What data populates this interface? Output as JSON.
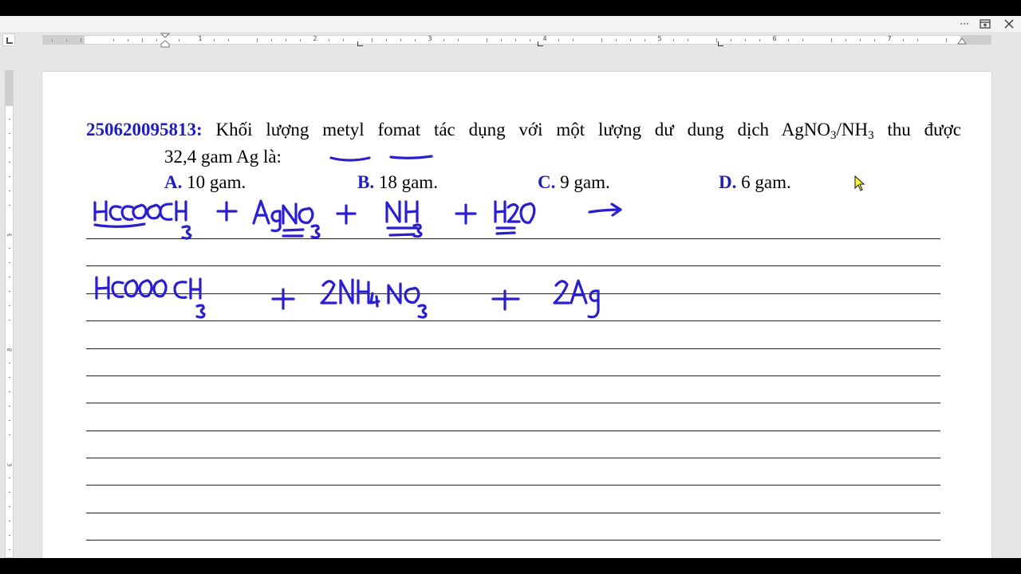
{
  "titlebar": {
    "more_icon": "more-icon",
    "restore_icon": "ribbon-display-icon",
    "close_icon": "close-icon"
  },
  "ruler": {
    "numbers": [
      "1",
      "2",
      "3",
      "4",
      "5",
      "6",
      "7"
    ],
    "vertical_numbers": [
      "1",
      "2",
      "3"
    ]
  },
  "question": {
    "id": "250620095813:",
    "text_before": " Khối lượng ",
    "underlined_1": "metyl",
    "text_mid": " ",
    "underlined_2": "fomat",
    "text_after": " tác dụng với một lượng dư dung dịch AgNO",
    "sub1": "3",
    "text_slash": "/NH",
    "sub2": "3",
    "text_end": " thu được",
    "line2": "32,4 gam Ag là:"
  },
  "options": [
    {
      "letter": "A.",
      "text": " 10 gam."
    },
    {
      "letter": "B.",
      "text": " 18 gam."
    },
    {
      "letter": "C.",
      "text": " 9 gam."
    },
    {
      "letter": "D.",
      "text": " 6 gam."
    }
  ],
  "handwriting": {
    "color": "#2a1ecf",
    "line1": "HCOOCH3 + AgNO3 + NH3 + H2O →",
    "line2": "HCOOOCH3 + 2NH4NO3 + 2Ag"
  },
  "colors": {
    "accent_blue": "#1f1fbf",
    "ink": "#2a1ecf"
  }
}
